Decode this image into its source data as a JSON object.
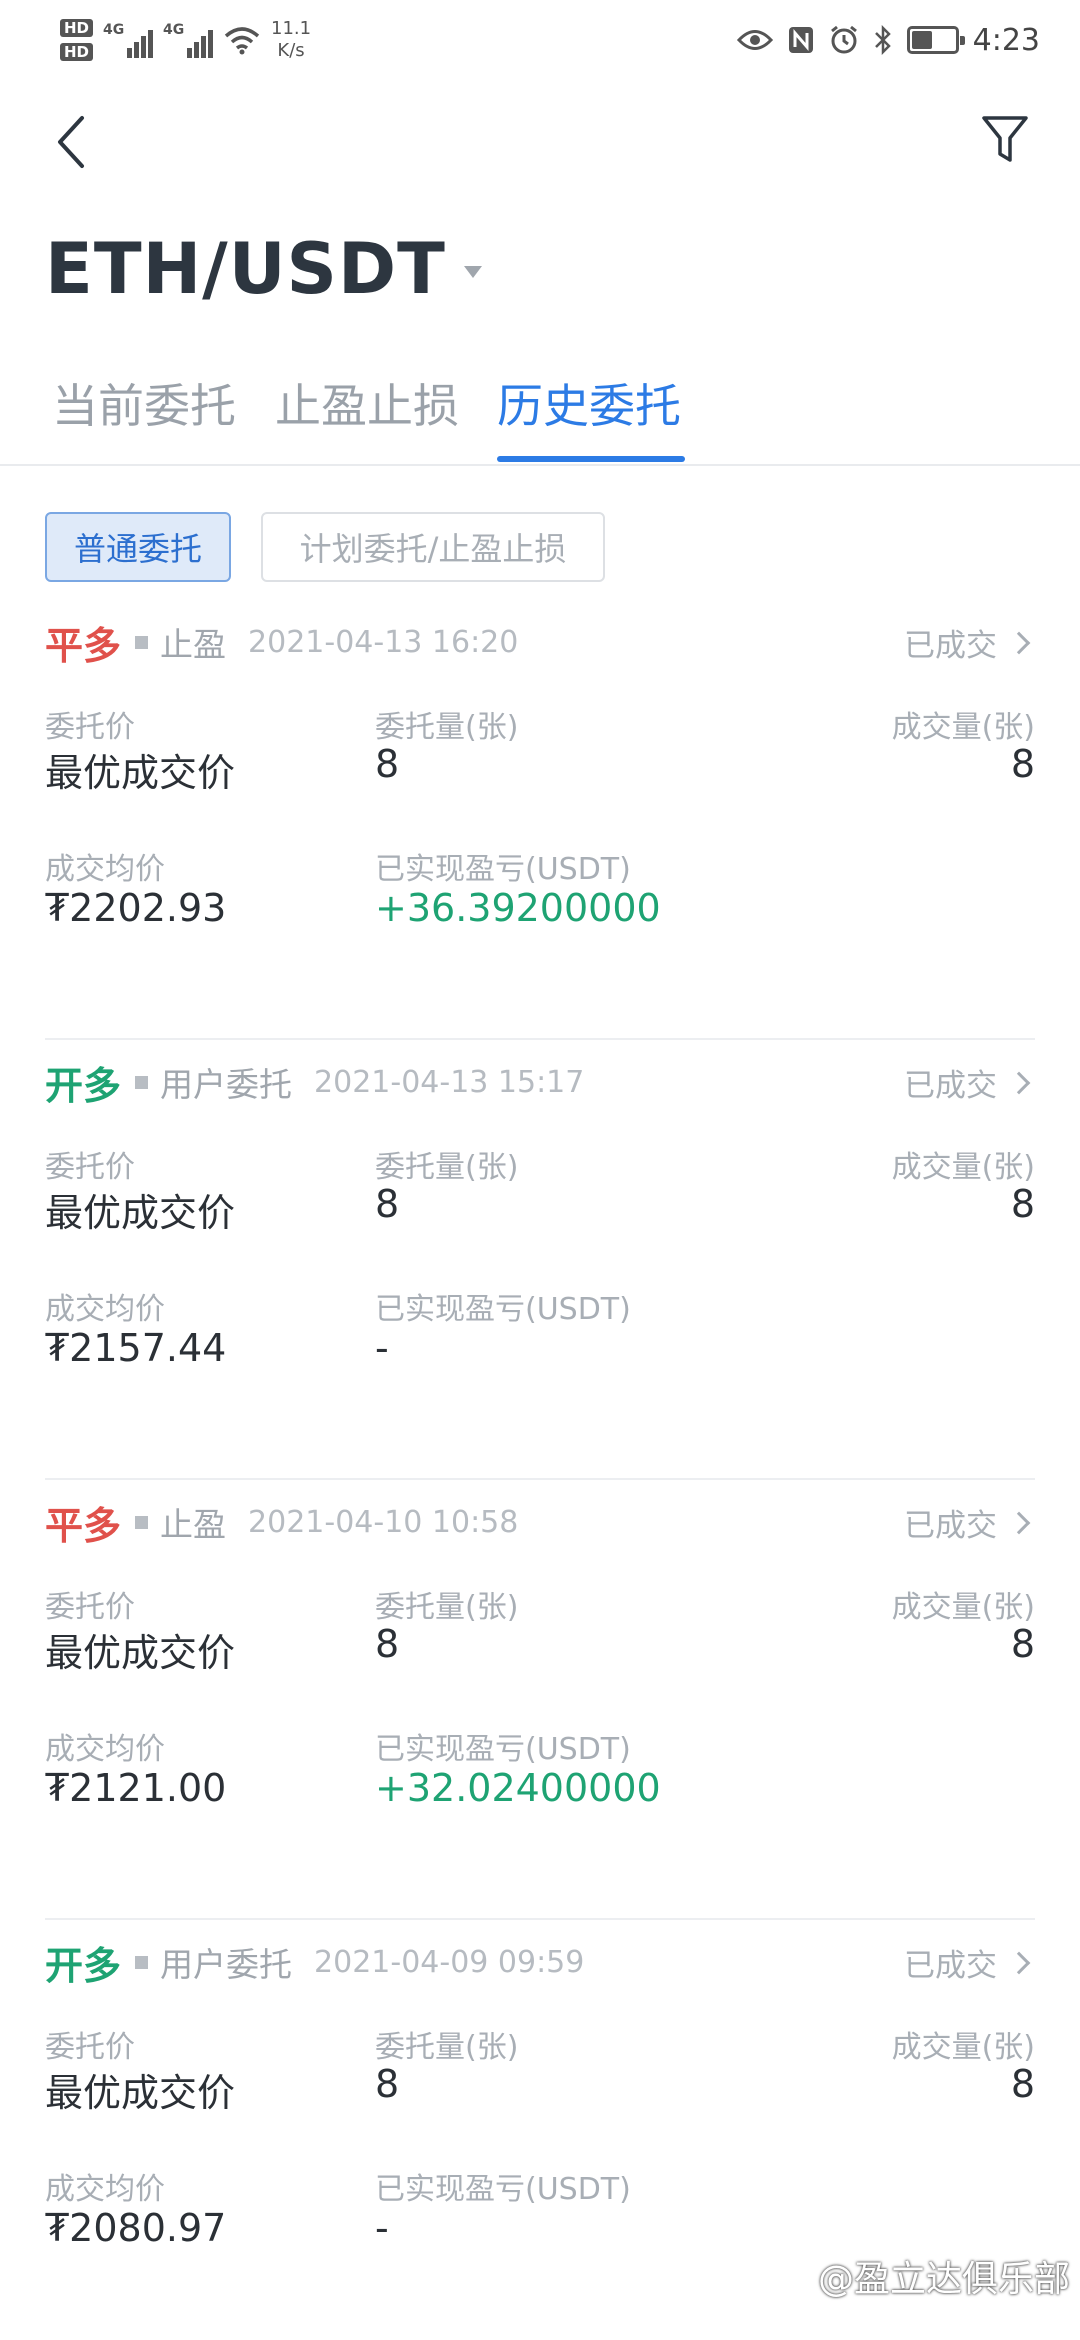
{
  "status_bar": {
    "hd1": "HD",
    "hd2": "HD",
    "net1": "4G",
    "net2": "4G",
    "speed_value": "11.1",
    "speed_unit": "K/s",
    "battery_level": 0.45,
    "time": "4:23"
  },
  "header": {
    "pair": "ETH/USDT"
  },
  "tabs": [
    {
      "label": "当前委托",
      "active": false
    },
    {
      "label": "止盈止损",
      "active": false
    },
    {
      "label": "历史委托",
      "active": true
    }
  ],
  "filters": {
    "normal_label": "普通委托",
    "plan_label": "计划委托/止盈止损"
  },
  "labels": {
    "entrust_price": "委托价",
    "entrust_qty": "委托量(张)",
    "filled_qty": "成交量(张)",
    "avg_price": "成交均价",
    "realized_pnl": "已实现盈亏(USDT)"
  },
  "orders": [
    {
      "side": "平多",
      "side_color": "#e0514b",
      "type": "止盈",
      "time": "2021-04-13 16:20",
      "status": "已成交",
      "entrust_price": "最优成交价",
      "entrust_qty": "8",
      "filled_qty": "8",
      "avg_price": "₮2202.93",
      "realized_pnl": "+36.39200000"
    },
    {
      "side": "开多",
      "side_color": "#1ea373",
      "type": "用户委托",
      "time": "2021-04-13 15:17",
      "status": "已成交",
      "entrust_price": "最优成交价",
      "entrust_qty": "8",
      "filled_qty": "8",
      "avg_price": "₮2157.44",
      "realized_pnl": "-"
    },
    {
      "side": "平多",
      "side_color": "#e0514b",
      "type": "止盈",
      "time": "2021-04-10 10:58",
      "status": "已成交",
      "entrust_price": "最优成交价",
      "entrust_qty": "8",
      "filled_qty": "8",
      "avg_price": "₮2121.00",
      "realized_pnl": "+32.02400000"
    },
    {
      "side": "开多",
      "side_color": "#1ea373",
      "type": "用户委托",
      "time": "2021-04-09 09:59",
      "status": "已成交",
      "entrust_price": "最优成交价",
      "entrust_qty": "8",
      "filled_qty": "8",
      "avg_price": "₮2080.97",
      "realized_pnl": "-"
    }
  ],
  "watermark": "@盈立达俱乐部"
}
